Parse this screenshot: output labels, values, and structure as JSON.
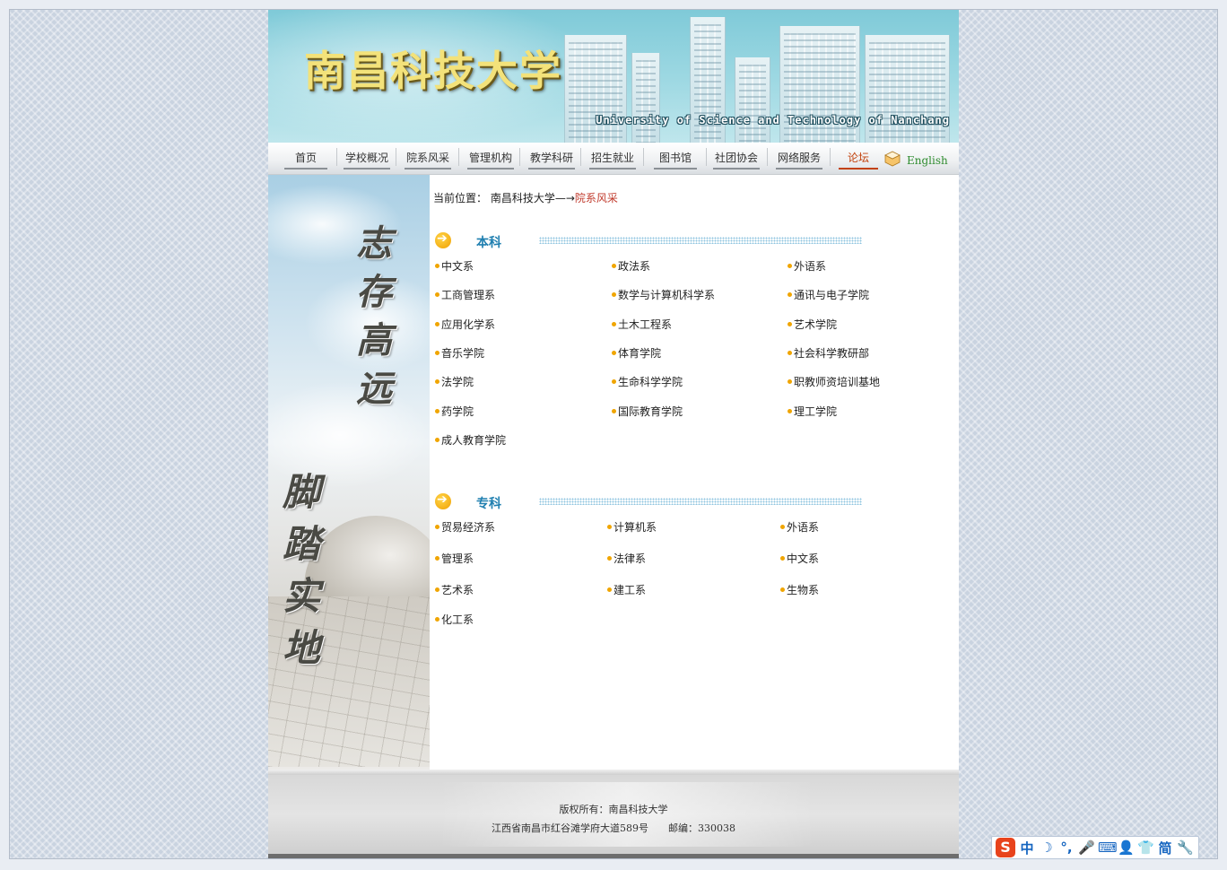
{
  "banner": {
    "title": "南昌科技大学",
    "subtitle": "University of Science and Technology of Nanchang"
  },
  "nav": {
    "items": [
      "首页",
      "学校概况",
      "院系风采",
      "管理机构",
      "教学科研",
      "招生就业",
      "图书馆",
      "社团协会",
      "网络服务",
      "论坛"
    ],
    "english": "English"
  },
  "side": {
    "calligraphy_top": "志存高远",
    "calligraphy_bottom": "脚踏实地"
  },
  "breadcrumb": {
    "label": "当前位置：",
    "path": "南昌科技大学",
    "arrow": "—→",
    "current": "院系风采"
  },
  "sections": {
    "undergrad": {
      "title": "本科",
      "departments": [
        "中文系",
        "政法系",
        "外语系",
        "工商管理系",
        "数学与计算机科学系",
        "通讯与电子学院",
        "应用化学系",
        "土木工程系",
        "艺术学院",
        "音乐学院",
        "体育学院",
        "社会科学教研部",
        "法学院",
        "生命科学学院",
        "职教师资培训基地",
        "药学院",
        "国际教育学院",
        "理工学院",
        "成人教育学院"
      ]
    },
    "college": {
      "title": "专科",
      "departments": [
        "贸易经济系",
        "计算机系",
        "外语系",
        "管理系",
        "法律系",
        "中文系",
        "艺术系",
        "建工系",
        "生物系",
        "化工系"
      ]
    }
  },
  "footer": {
    "line1": "版权所有：南昌科技大学",
    "line2": "江西省南昌市红谷滩学府大道589号　　邮编：330038"
  },
  "ime": {
    "logo": "S",
    "buttons": [
      "中",
      "☽",
      "°,",
      "🎤",
      "⌨",
      "👤",
      "👕",
      "简",
      "🔧"
    ]
  },
  "colors": {
    "accent_blue": "#1f7fb0",
    "highlight_red": "#c0392b",
    "bullet_orange": "#f0a500"
  }
}
